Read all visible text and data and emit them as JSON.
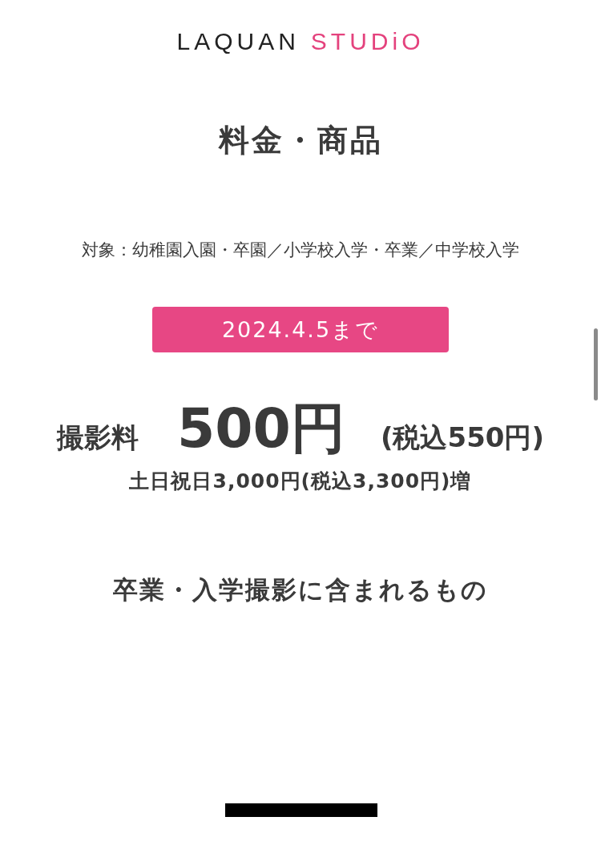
{
  "logo": {
    "primary": "LAQUAN",
    "secondary": "STUDiO"
  },
  "title": "料金・商品",
  "target": "対象：幼稚園入園・卒園／小学校入学・卒業／中学校入学",
  "deadline_badge": "2024.4.5まで",
  "price": {
    "label": "撮影料",
    "amount": "500円",
    "tax_note": "(税込550円)",
    "surcharge": "土日祝日3,000円(税込3,300円)増"
  },
  "section_heading": "卒業・入学撮影に含まれるもの"
}
